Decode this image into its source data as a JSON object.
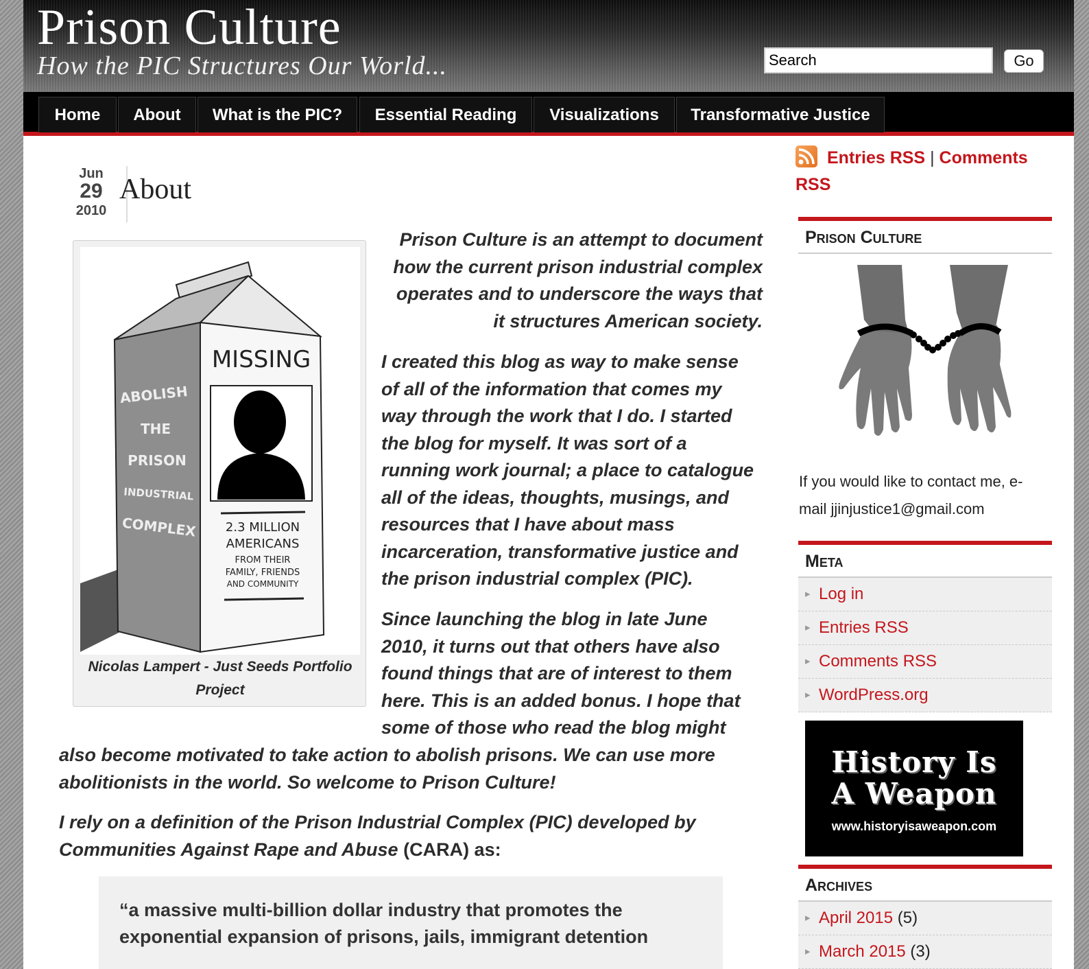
{
  "header": {
    "site_title": "Prison Culture",
    "site_description": "How the PIC Structures Our World...",
    "search_value": "Search",
    "go_label": "Go"
  },
  "nav": {
    "items": [
      "Home",
      "About",
      "What is the PIC?",
      "Essential Reading",
      "Visualizations",
      "Transformative Justice"
    ]
  },
  "post": {
    "date": {
      "month": "Jun",
      "day": "29",
      "year": "2010"
    },
    "title": "About",
    "figure": {
      "carton_missing": "MISSING",
      "carton_side": [
        "ABOLISH",
        "THE",
        "PRISON",
        "INDUSTRIAL",
        "COMPLEX"
      ],
      "carton_stats": [
        "2.3 MILLION",
        "AMERICANS",
        "FROM THEIR",
        "FAMILY, FRIENDS",
        "AND COMMUNITY"
      ],
      "caption_lines": [
        "Nicolas Lampert - Just Seeds Portfolio",
        "Project"
      ]
    },
    "intro_lines": [
      "Prison Culture is an attempt to document",
      "how the current prison industrial complex",
      "operates and to underscore the ways that",
      "it structures American society."
    ],
    "p1_lines": [
      "I created this blog as way to make sense",
      "of all of the information that comes my",
      "way through the work that I do.  I started",
      "the blog for myself. It was sort of a",
      "running work journal; a place to catalogue",
      "all of the ideas, thoughts, musings, and",
      "resources that I have about mass",
      "incarceration, transformative justice and",
      "the prison industrial complex (PIC)."
    ],
    "p2_lines": [
      "Since launching the blog in late June",
      "2010, it turns out that others have also",
      "found things that are of interest to them",
      "here. This is an added bonus. I hope that",
      "some of those who read the blog might"
    ],
    "p2b_lines": [
      "also become motivated to take action to abolish prisons. We can use more",
      "abolitionists in the world. So welcome to Prison Culture!"
    ],
    "p3_line1": "I rely on a definition of the Prison Industrial Complex (PIC) developed by",
    "p3_line2_italic": "Communities Against Rape and Abuse",
    "p3_line2_plain": " (CARA) as:",
    "quote_lines": [
      "“a massive multi-billion dollar industry that promotes the",
      "exponential expansion of prisons, jails, immigrant detention"
    ]
  },
  "sidebar": {
    "rss": {
      "entries": "Entries RSS",
      "separator": "|",
      "comments_a": "Comments",
      "comments_b": "RSS"
    },
    "widget1_title": "Prison Culture",
    "contact_lines": [
      "If you would like to contact me, e-",
      "mail jjinjustice1@gmail.com"
    ],
    "widget2_title": "Meta",
    "meta_items": [
      "Log in",
      "Entries RSS",
      "Comments RSS",
      "WordPress.org"
    ],
    "banner": {
      "line1": "History Is",
      "line2": "A Weapon",
      "url": "www.historyisaweapon.com"
    },
    "widget3_title": "Archives",
    "archives": [
      {
        "label": "April 2015",
        "count": "(5)"
      },
      {
        "label": "March 2015",
        "count": "(3)"
      }
    ]
  },
  "colors": {
    "accent": "#c4161c",
    "nav_bg": "#000000",
    "text": "#2c2c2c"
  }
}
